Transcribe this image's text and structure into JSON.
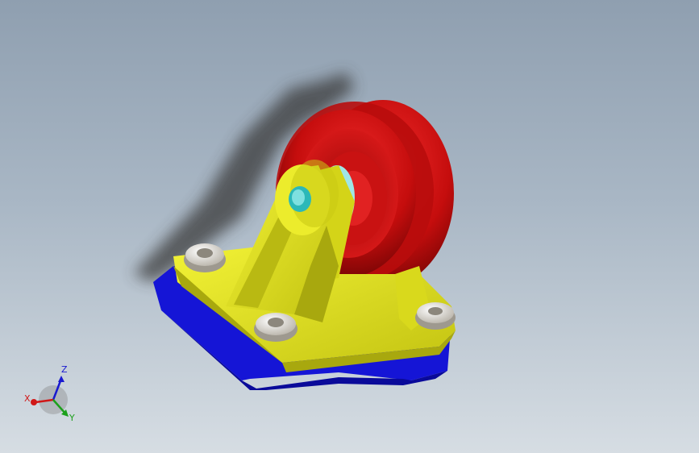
{
  "colors": {
    "background_top": "#8f9fb0",
    "background_bottom": "#d6dde3",
    "bracket_yellow": "#e5e51a",
    "bracket_dark": "#a8a80e",
    "base_blue": "#1515d6",
    "base_blue_dark": "#0a0a9a",
    "wheel_red": "#d11414",
    "wheel_red_dark": "#7a0505",
    "hub_cyan": "#9fe6e6",
    "pin_teal": "#2cb8b8",
    "bolt_gray": "#e4e0d8",
    "shadow": "#3a3a3a",
    "axis_x": "#d01818",
    "axis_y": "#1ca01c",
    "axis_z": "#1818d0"
  },
  "triad": {
    "x_label": "X",
    "y_label": "Y",
    "z_label": "Z"
  },
  "model": {
    "parts": [
      "base-plate",
      "bracket",
      "wheel",
      "hub",
      "pin",
      "bolt-1",
      "bolt-2",
      "bolt-3"
    ],
    "icons": [
      "reference-triad-icon"
    ]
  }
}
